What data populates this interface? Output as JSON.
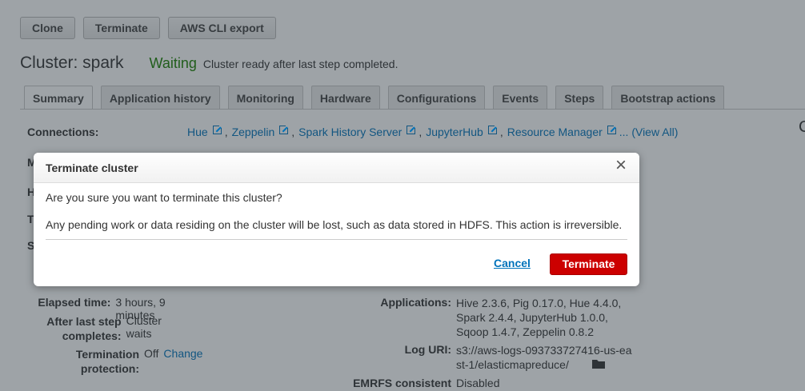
{
  "toolbar": {
    "clone_label": "Clone",
    "terminate_label": "Terminate",
    "cli_export_label": "AWS CLI export"
  },
  "cluster": {
    "title": "Cluster: spark",
    "status": "Waiting",
    "status_message": "Cluster ready after last step completed.",
    "status_color": "#1d8102"
  },
  "tabs": [
    {
      "label": "Summary",
      "active": true
    },
    {
      "label": "Application history"
    },
    {
      "label": "Monitoring"
    },
    {
      "label": "Hardware"
    },
    {
      "label": "Configurations"
    },
    {
      "label": "Events"
    },
    {
      "label": "Steps"
    },
    {
      "label": "Bootstrap actions"
    }
  ],
  "connections": {
    "label": "Connections:",
    "links": [
      "Hue",
      "Zeppelin",
      "Spark History Server",
      "JupyterHub",
      "Resource Manager"
    ],
    "more": "... (View All)"
  },
  "clipped_labels": [
    "M",
    "H",
    "T",
    "S"
  ],
  "right_clip": "C",
  "details_left": [
    {
      "label": "Elapsed time:",
      "value": "3 hours, 9 minutes"
    },
    {
      "label": "After last step completes:",
      "value": "Cluster waits"
    },
    {
      "label": "Termination protection:",
      "value": "Off",
      "link": "Change"
    }
  ],
  "details_right": [
    {
      "label": "Applications:",
      "value": "Hive 2.3.6, Pig 0.17.0, Hue 4.4.0, Spark 2.4.4, JupyterHub 1.0.0, Sqoop 1.4.7, Zeppelin 0.8.2"
    },
    {
      "label": "Log URI:",
      "value": "s3://aws-logs-093733727416-us-east-1/elasticmapreduce/"
    },
    {
      "label": "EMRFS consistent",
      "value": "Disabled"
    }
  ],
  "modal": {
    "title": "Terminate cluster",
    "question": "Are you sure you want to terminate this cluster?",
    "warning": "Any pending work or data residing on the cluster will be lost, such as data stored in HDFS. This action is irreversible.",
    "cancel_label": "Cancel",
    "terminate_label": "Terminate",
    "terminate_color": "#cc0000"
  }
}
